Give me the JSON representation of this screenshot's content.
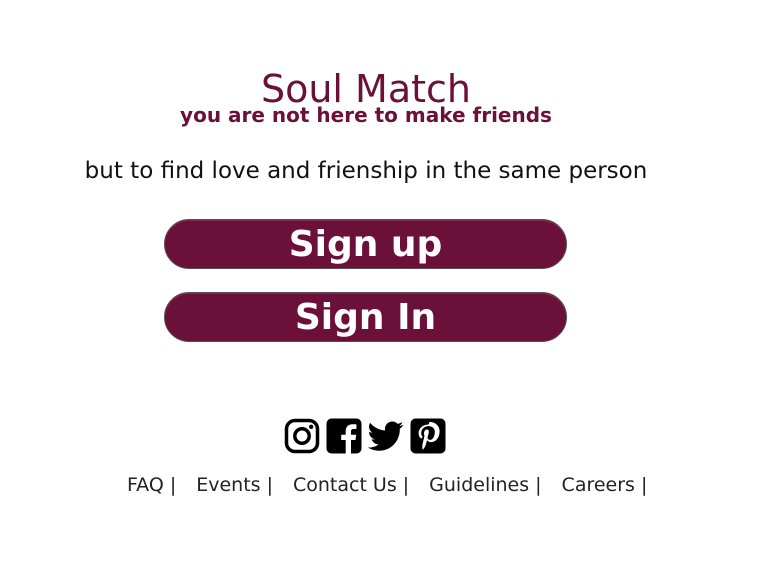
{
  "header": {
    "title": "Soul Match",
    "tagline": "you are not here to make friends",
    "subline": "but to find love and frienship in the same person"
  },
  "actions": {
    "signup_label": "Sign up",
    "signin_label": "Sign In"
  },
  "social": {
    "icons": [
      "instagram-icon",
      "facebook-icon",
      "twitter-icon",
      "pinterest-icon"
    ]
  },
  "footer": {
    "links": [
      "FAQ",
      "Events",
      "Contact Us",
      "Guidelines",
      "Careers"
    ],
    "separator": "|"
  },
  "colors": {
    "brand": "#6a1039",
    "text": "#111111"
  }
}
